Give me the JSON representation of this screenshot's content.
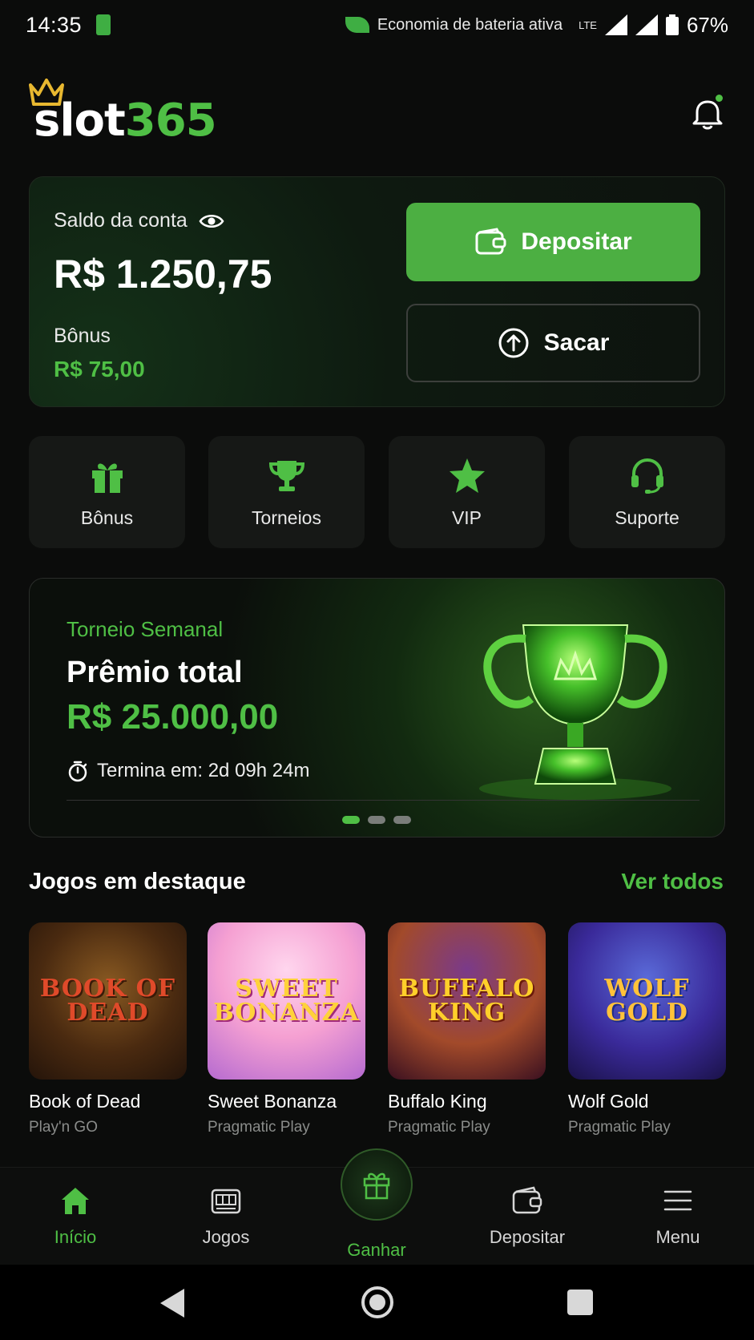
{
  "status_bar": {
    "time": "14:35",
    "battery_saver_text": "Economia de bateria ativa",
    "network": "LTE",
    "battery_percent": "67%"
  },
  "header": {
    "logo_part1": "slot",
    "logo_part2": "365"
  },
  "balance": {
    "label": "Saldo da conta",
    "amount": "R$ 1.250,75",
    "bonus_label": "Bônus",
    "bonus_amount": "R$ 75,00",
    "deposit_button": "Depositar",
    "withdraw_button": "Sacar"
  },
  "quick_actions": [
    {
      "label": "Bônus",
      "icon": "gift-icon"
    },
    {
      "label": "Torneios",
      "icon": "trophy-icon"
    },
    {
      "label": "VIP",
      "icon": "star-icon"
    },
    {
      "label": "Suporte",
      "icon": "headset-icon"
    }
  ],
  "banner": {
    "tag": "Torneio Semanal",
    "title": "Prêmio total",
    "prize": "R$ 25.000,00",
    "ends": "Termina em: 2d 09h 24m",
    "slides": 3,
    "active_slide": 0
  },
  "featured": {
    "title": "Jogos em destaque",
    "see_all": "Ver todos",
    "games": [
      {
        "name": "Book of Dead",
        "provider": "Play'n GO",
        "art_text": "BOOK OF DEAD"
      },
      {
        "name": "Sweet Bonanza",
        "provider": "Pragmatic Play",
        "art_text": "SWEET BONANZA"
      },
      {
        "name": "Buffalo King",
        "provider": "Pragmatic Play",
        "art_text": "BUFFALO KING"
      },
      {
        "name": "Wolf Gold",
        "provider": "Pragmatic Play",
        "art_text": "WOLF GOLD"
      }
    ]
  },
  "bottom_nav": [
    {
      "label": "Início",
      "icon": "home-icon",
      "active": true
    },
    {
      "label": "Jogos",
      "icon": "slot-machine-icon"
    },
    {
      "label": "Ganhar",
      "icon": "gift-icon"
    },
    {
      "label": "Depositar",
      "icon": "wallet-icon"
    },
    {
      "label": "Menu",
      "icon": "menu-icon"
    }
  ],
  "colors": {
    "accent": "#4fbf45",
    "background": "#0b0c0b",
    "card": "#161816"
  }
}
